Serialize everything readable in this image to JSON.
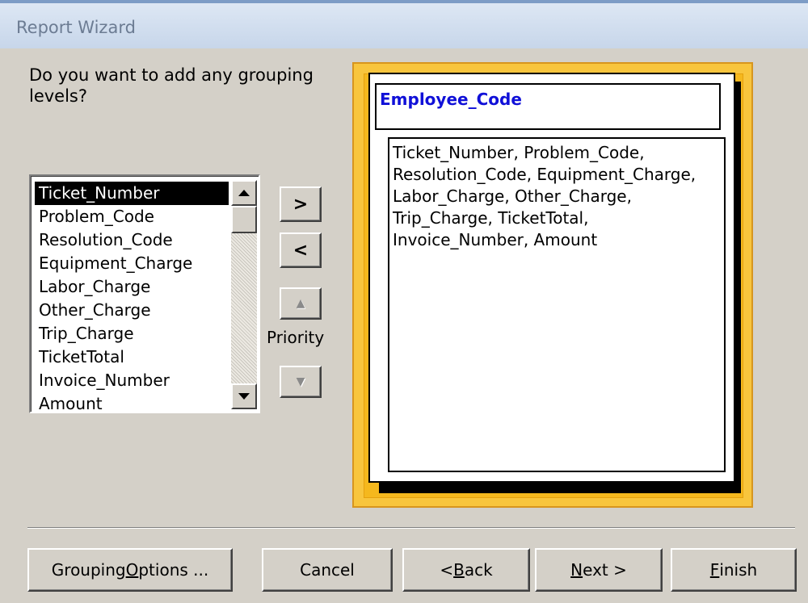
{
  "window": {
    "title": "Report Wizard"
  },
  "prompt": {
    "question": "Do you want to add any grouping levels?"
  },
  "field_list": {
    "items": [
      "Ticket_Number",
      "Problem_Code",
      "Resolution_Code",
      "Equipment_Charge",
      "Labor_Charge",
      "Other_Charge",
      "Trip_Charge",
      "TicketTotal",
      "Invoice_Number",
      "Amount"
    ],
    "selected_index": 0
  },
  "move_buttons": {
    "add_label": ">",
    "remove_label": "<"
  },
  "priority": {
    "label": "Priority",
    "up_icon": "up-arrow-icon",
    "down_icon": "down-arrow-icon"
  },
  "preview": {
    "group_field": "Employee_Code",
    "detail_fields": "Ticket_Number, Problem_Code, Resolution_Code, Equipment_Charge, Labor_Charge, Other_Charge, Trip_Charge, TicketTotal, Invoice_Number, Amount",
    "group_title_color": "#1010d8",
    "frame_color": "#f5b81d"
  },
  "buttons": {
    "grouping_options": {
      "pre": "Grouping ",
      "accel": "O",
      "post": "ptions ..."
    },
    "cancel": "Cancel",
    "back": {
      "pre": "< ",
      "accel": "B",
      "post": "ack"
    },
    "next": {
      "pre": "",
      "accel": "N",
      "post": "ext >"
    },
    "finish": {
      "pre": "",
      "accel": "F",
      "post": "inish"
    }
  }
}
